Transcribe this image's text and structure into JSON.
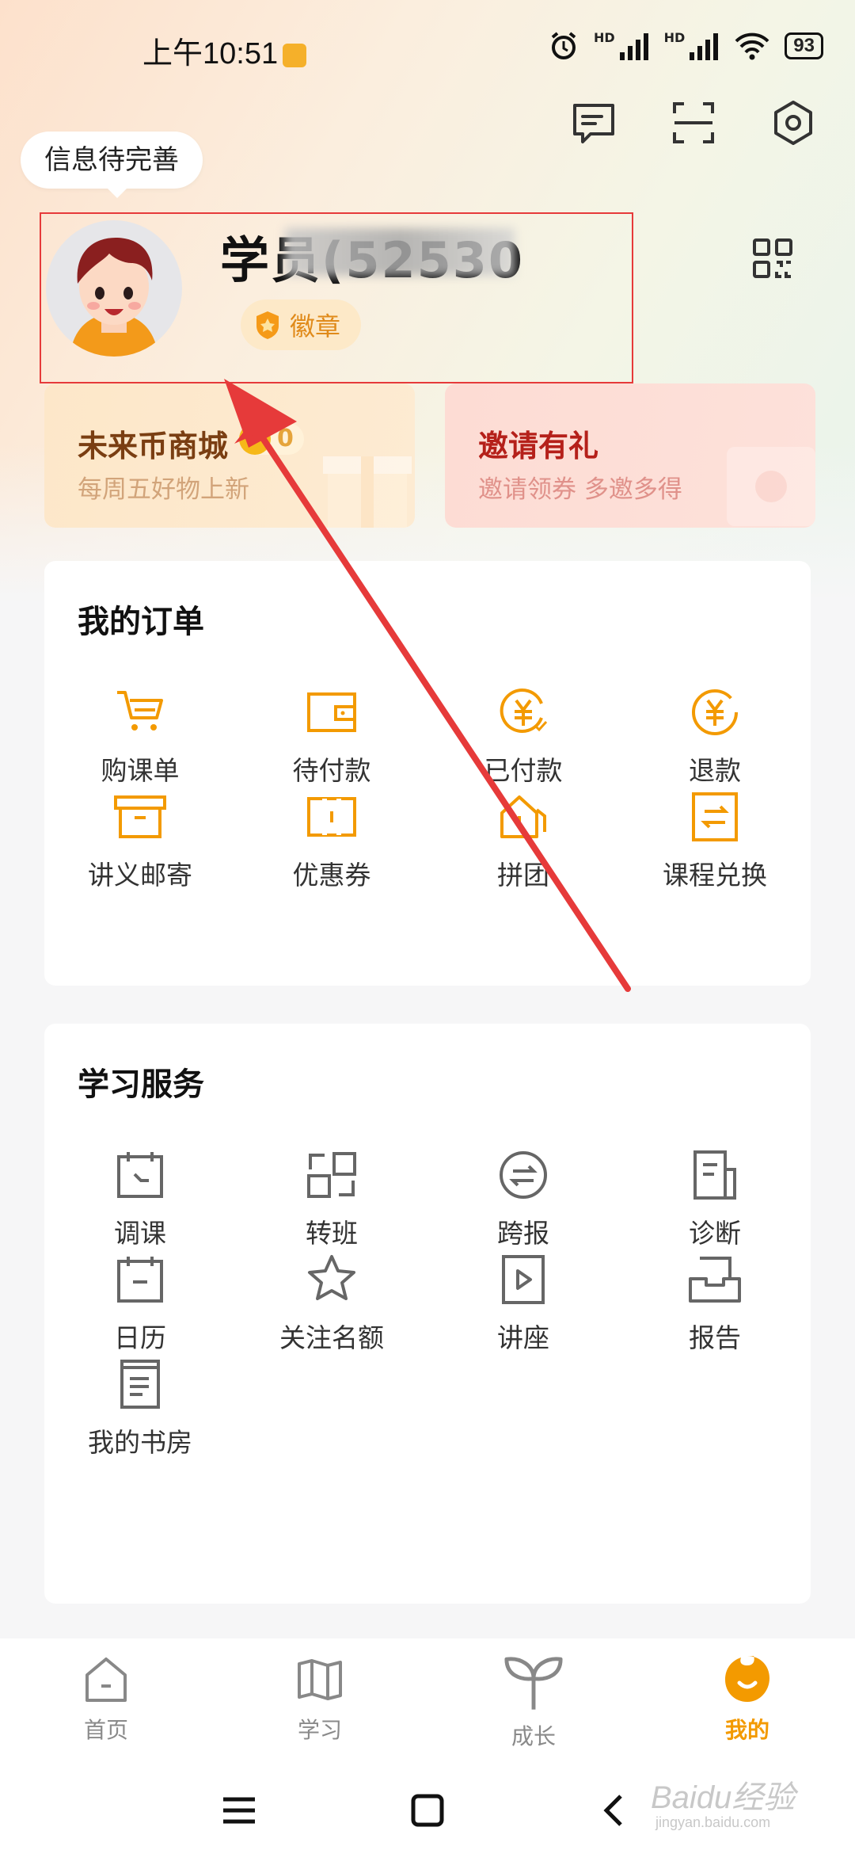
{
  "status_bar": {
    "time": "上午10:51",
    "network_1": "HD",
    "network_2": "HD",
    "battery": "93"
  },
  "tooltip": "信息待完善",
  "profile": {
    "name": "学员(52530",
    "badge": "徽章"
  },
  "promos": [
    {
      "title": "未来币商城",
      "subtitle": "每周五好物上新",
      "coins": "0"
    },
    {
      "title": "邀请有礼",
      "subtitle": "邀请领券 多邀多得"
    }
  ],
  "orders": {
    "title": "我的订单",
    "items": [
      {
        "label": "购课单",
        "icon": "cart-icon"
      },
      {
        "label": "待付款",
        "icon": "wallet-icon"
      },
      {
        "label": "已付款",
        "icon": "yuan-check-icon"
      },
      {
        "label": "退款",
        "icon": "yuan-refund-icon"
      },
      {
        "label": "讲义邮寄",
        "icon": "box-icon"
      },
      {
        "label": "优惠券",
        "icon": "coupon-icon"
      },
      {
        "label": "拼团",
        "icon": "group-house-icon"
      },
      {
        "label": "课程兑换",
        "icon": "exchange-icon"
      }
    ]
  },
  "services": {
    "title": "学习服务",
    "items": [
      {
        "label": "调课",
        "icon": "calendar-arrow-icon"
      },
      {
        "label": "转班",
        "icon": "transfer-icon"
      },
      {
        "label": "跨报",
        "icon": "cross-circle-icon"
      },
      {
        "label": "诊断",
        "icon": "document-icon"
      },
      {
        "label": "日历",
        "icon": "calendar-icon"
      },
      {
        "label": "关注名额",
        "icon": "star-icon"
      },
      {
        "label": "讲座",
        "icon": "play-icon"
      },
      {
        "label": "报告",
        "icon": "tray-icon"
      },
      {
        "label": "我的书房",
        "icon": "book-icon"
      }
    ]
  },
  "nav": [
    {
      "label": "首页",
      "icon": "home-icon"
    },
    {
      "label": "学习",
      "icon": "book-open-icon"
    },
    {
      "label": "成长",
      "icon": "sprout-icon"
    },
    {
      "label": "我的",
      "icon": "me-icon",
      "active": true
    }
  ],
  "watermark": {
    "text": "Baidu经验",
    "sub": "jingyan.baidu.com"
  },
  "colors": {
    "accent": "#f39a00",
    "annotation": "#e63a3a"
  }
}
